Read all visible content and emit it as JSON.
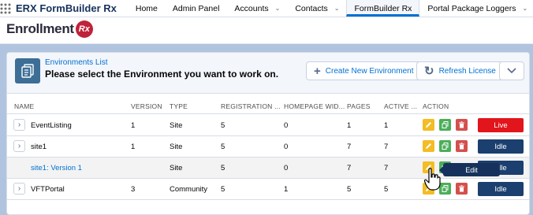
{
  "app": {
    "name": "ERX FormBuilder Rx"
  },
  "nav": {
    "items": [
      {
        "label": "Home",
        "dropdown": false,
        "active": false
      },
      {
        "label": "Admin Panel",
        "dropdown": false,
        "active": false
      },
      {
        "label": "Accounts",
        "dropdown": true,
        "active": false
      },
      {
        "label": "Contacts",
        "dropdown": true,
        "active": false
      },
      {
        "label": "FormBuilder Rx",
        "dropdown": false,
        "active": true
      },
      {
        "label": "Portal Package Loggers",
        "dropdown": true,
        "active": false
      }
    ]
  },
  "brand": {
    "logo_text": "Enrollment",
    "logo_badge": "Rx"
  },
  "card": {
    "subtitle": "Environments List",
    "title": "Please select the Environment you want to work on.",
    "create_button": "Create New Environment",
    "refresh_button": "Refresh License"
  },
  "table": {
    "columns": [
      "NAME",
      "VERSION",
      "TYPE",
      "REGISTRATION ...",
      "HOMEPAGE WID...",
      "PAGES",
      "ACTIVE ...",
      "ACTION"
    ],
    "rows": [
      {
        "name": "EventListing",
        "version": "1",
        "type": "Site",
        "registration": "5",
        "homepage": "0",
        "pages": "1",
        "active": "1",
        "status": "Live",
        "expandable": true,
        "child": false
      },
      {
        "name": "site1",
        "version": "1",
        "type": "Site",
        "registration": "5",
        "homepage": "0",
        "pages": "7",
        "active": "7",
        "status": "Idle",
        "expandable": true,
        "child": false
      },
      {
        "name": "site1: Version 1",
        "version": "",
        "type": "Site",
        "registration": "5",
        "homepage": "0",
        "pages": "7",
        "active": "7",
        "status": "Idle",
        "expandable": false,
        "child": true
      },
      {
        "name": "VFTPortal",
        "version": "3",
        "type": "Community",
        "registration": "5",
        "homepage": "1",
        "pages": "5",
        "active": "5",
        "status": "Idle",
        "expandable": true,
        "child": false
      }
    ]
  },
  "tooltip": {
    "text": "Edit"
  },
  "colors": {
    "accent": "#0070d2",
    "live": "#e2141c",
    "idle": "#1b3f6e",
    "edit": "#f4bc25",
    "clone": "#4bae59",
    "delete": "#d4504c",
    "page_bg": "#b0c4df"
  },
  "icons": {
    "app_launcher": "waffle-grid-icon",
    "header": "document-list-icon",
    "create": "plus-icon",
    "refresh": "refresh-icon",
    "more": "chevron-down-icon",
    "edit": "pencil-icon",
    "clone": "copy-icon",
    "delete": "trash-icon"
  }
}
